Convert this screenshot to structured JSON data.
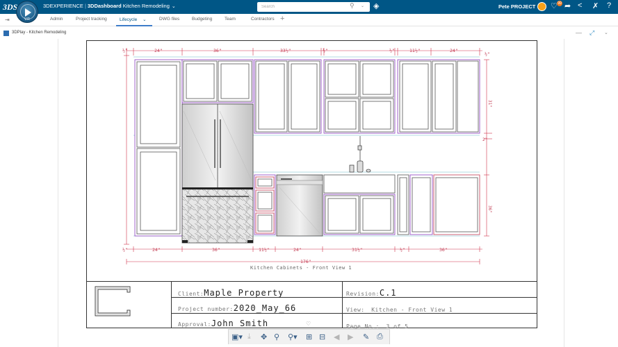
{
  "topbar": {
    "logo": "3DS",
    "compass_label": "V.R",
    "brand_platform": "3DEXPERIENCE",
    "brand_app": "3DDashboard",
    "brand_dashboard": "Kitchen Remodeling",
    "search_placeholder": "Search",
    "user_name": "Pete PROJECT",
    "notification_count": "99"
  },
  "tabs": [
    {
      "label": "Admin"
    },
    {
      "label": "Project tracking"
    },
    {
      "label": "Lifecycle",
      "active": true
    },
    {
      "label": "DWG files"
    },
    {
      "label": "Budgeting"
    },
    {
      "label": "Team"
    },
    {
      "label": "Contractors"
    }
  ],
  "widget": {
    "title": "3DPlay - Kitchen Remodeling"
  },
  "drawing": {
    "caption": "Kitchen Cabinets - Front View 1",
    "dims_top": [
      "24\"",
      "36\"",
      "33½\"",
      "½\"",
      "½\"",
      "11½\"",
      "24\"",
      "½\""
    ],
    "dims_bottom": [
      "24\"",
      "36\"",
      "11½\"",
      "24\"",
      "31½\"",
      "½\"",
      "36\""
    ],
    "dim_overall": "176\"",
    "dims_right": [
      "31\"",
      "2\"",
      "36\""
    ]
  },
  "title_block": {
    "client_label": "Client:",
    "client_value": "Maple Property",
    "revision_label": "Revision:",
    "revision_value": "C.1",
    "project_label": "Project number:",
    "project_value": "2020_May_66",
    "view_label": "View:",
    "view_value": "Kitchen - Front View 1",
    "approval_label": "Approval:",
    "approval_value": "John Smith",
    "page_label": "Page No.:",
    "page_value": "3 of 5"
  }
}
